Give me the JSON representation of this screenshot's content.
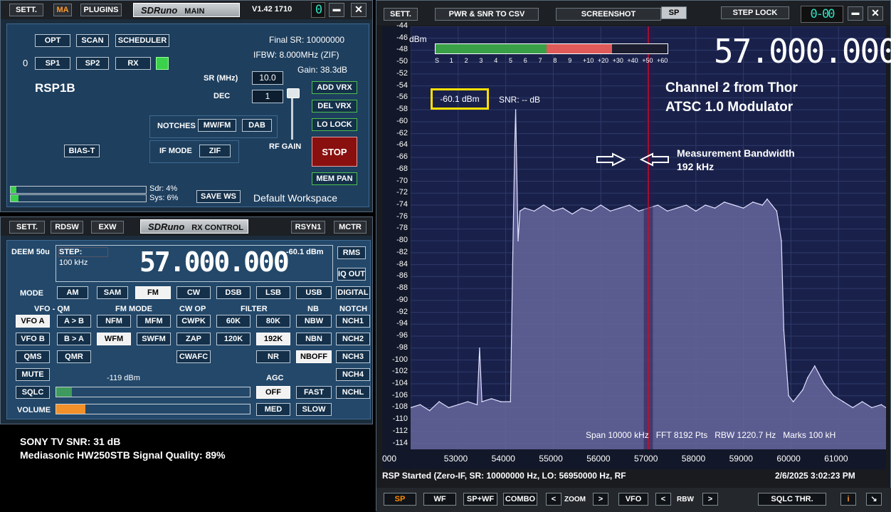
{
  "main_window": {
    "buttons": {
      "sett": "SETT.",
      "ma": "MA",
      "plugins": "PLUGINS"
    },
    "logo": "SDRuno",
    "logo_label": "MAIN",
    "version": "V1.42 1710",
    "counter": "0",
    "opt": "OPT",
    "scan": "SCAN",
    "scheduler": "SCHEDULER",
    "zero": "0",
    "sp1": "SP1",
    "sp2": "SP2",
    "rx": "RX",
    "device": "RSP1B",
    "final_sr": "Final SR: 10000000",
    "ifbw": "IFBW: 8.000MHz (ZIF)",
    "gain": "Gain: 38.3dB",
    "sr_label": "SR (MHz)",
    "sr_value": "10.0",
    "dec_label": "DEC",
    "dec_value": "1",
    "add_vrx": "ADD VRX",
    "del_vrx": "DEL VRX",
    "lo_lock": "LO LOCK",
    "notches_label": "NOTCHES",
    "mwfm": "MW/FM",
    "dab": "DAB",
    "ifmode_label": "IF MODE",
    "zif": "ZIF",
    "rfgain_label": "RF GAIN",
    "stop": "STOP",
    "bias_t": "BIAS-T",
    "mem_pan": "MEM PAN",
    "sdr_load": "Sdr: 4%",
    "sys_load": "Sys: 6%",
    "sdr_pct": 4,
    "sys_pct": 6,
    "save_ws": "SAVE WS",
    "workspace": "Default Workspace"
  },
  "rx_control": {
    "sett": "SETT.",
    "rdsw": "RDSW",
    "exw": "EXW",
    "logo": "SDRuno",
    "logo_label": "RX CONTROL",
    "rsyn1": "RSYN1",
    "mctr": "MCTR",
    "deem": "DEEM 50u",
    "step_label": "STEP:",
    "step_value": "100 kHz",
    "frequency": "57.000.000",
    "level": "-60.1 dBm",
    "rms": "RMS",
    "iq_out": "IQ OUT",
    "digital": "DIGITAL",
    "mode_label": "MODE",
    "modes": [
      "AM",
      "SAM",
      "FM",
      "CW",
      "DSB",
      "LSB",
      "USB"
    ],
    "hdr_vfo": "VFO - QM",
    "hdr_fm": "FM MODE",
    "hdr_cw": "CW OP",
    "hdr_filter": "FILTER",
    "hdr_nb": "NB",
    "hdr_notch": "NOTCH",
    "vfoa": "VFO A",
    "atob": "A > B",
    "nfm": "NFM",
    "mfm": "MFM",
    "cwpk": "CWPK",
    "f60k": "60K",
    "f80k": "80K",
    "nbw": "NBW",
    "nch1": "NCH1",
    "vfob": "VFO B",
    "btoa": "B > A",
    "wfm": "WFM",
    "swfm": "SWFM",
    "zap": "ZAP",
    "f120k": "120K",
    "f192k": "192K",
    "nbn": "NBN",
    "nch2": "NCH2",
    "qms": "QMS",
    "qmr": "QMR",
    "cwafc": "CWAFC",
    "nr": "NR",
    "nboff": "NBOFF",
    "nch3": "NCH3",
    "mute": "MUTE",
    "nch4": "NCH4",
    "sql_level": "-119 dBm",
    "agc_label": "AGC",
    "sqlc": "SQLC",
    "off": "OFF",
    "fast": "FAST",
    "nchl": "NCHL",
    "volume": "VOLUME",
    "med": "MED",
    "slow": "SLOW",
    "squelch_pct": 8,
    "volume_pct": 15
  },
  "annotation": {
    "line1": "SONY TV SNR: 31 dB",
    "line2": "Mediasonic HW250STB Signal Quality: 89%"
  },
  "spectrum": {
    "sett": "SETT.",
    "pwr_snr": "PWR & SNR TO CSV",
    "screenshot": "SCREENSHOT",
    "sp": "SP",
    "step_lock": "STEP LOCK",
    "counter": "0-00",
    "dbm_unit": "dBm",
    "smeter_labels": [
      "S",
      "1",
      "2",
      "3",
      "4",
      "5",
      "6",
      "7",
      "8",
      "9",
      "+10",
      "+20",
      "+30",
      "+40",
      "+50",
      "+60"
    ],
    "frequency": "57.000.000",
    "level_box": "-60.1 dBm",
    "snr": "SNR: -- dB",
    "title1": "Channel 2 from Thor",
    "title2": "ATSC 1.0 Modulator",
    "meas1": "Measurement Bandwidth",
    "meas2": "192 kHz",
    "info": "Span 10000 kHz   FFT 8192 Pts   RBW 1220.7 Hz   Marks 100 kH",
    "status": "RSP Started (Zero-IF, SR: 10000000 Hz, LO: 56950000 Hz, RF",
    "datetime": "2/6/2025 3:02:23 PM",
    "bottom": {
      "sp": "SP",
      "wf": "WF",
      "spwf": "SP+WF",
      "combo": "COMBO",
      "lt": "<",
      "zoom": "ZOOM",
      "gt": ">",
      "vfo": "VFO",
      "rbw": "RBW",
      "sqlc_thr": "SQLC THR.",
      "info": "i"
    },
    "colors": {
      "plot_bg": "#19214a",
      "trace": "#e0e0ff",
      "fill": "#6a6aa0",
      "marker": "#c0102a",
      "box": "#ffe000"
    }
  },
  "chart_data": {
    "type": "area",
    "xlabel": "",
    "ylabel": "dBm",
    "xlim": [
      52000,
      62000
    ],
    "ylim": [
      -115,
      -44
    ],
    "x_ticks": [
      "000",
      "53000",
      "54000",
      "55000",
      "56000",
      "57000",
      "58000",
      "59000",
      "60000",
      "61000"
    ],
    "y_ticks": [
      -44,
      -46,
      -48,
      -50,
      -52,
      -54,
      -56,
      -58,
      -60,
      -62,
      -64,
      -66,
      -68,
      -70,
      -72,
      -74,
      -76,
      -78,
      -80,
      -82,
      -84,
      -86,
      -88,
      -90,
      -92,
      -94,
      -96,
      -98,
      -100,
      -102,
      -104,
      -106,
      -108,
      -110,
      -112,
      -114
    ],
    "x_khz": [
      52000,
      52200,
      52400,
      52600,
      52800,
      53000,
      53200,
      53400,
      53450,
      53500,
      53700,
      53900,
      54100,
      54150,
      54190,
      54210,
      54260,
      54300,
      54400,
      54600,
      54800,
      55000,
      55200,
      55400,
      55600,
      55800,
      56000,
      56200,
      56400,
      56600,
      56800,
      57000,
      57200,
      57400,
      57600,
      57800,
      58000,
      58200,
      58400,
      58600,
      58800,
      59000,
      59200,
      59400,
      59500,
      59600,
      59700,
      59800,
      59850,
      59950,
      60050,
      60150,
      60250,
      60350,
      60500,
      60700,
      60900,
      61100,
      61300,
      61500,
      61700,
      61900,
      62000
    ],
    "y_dbm": [
      -108,
      -107.5,
      -108.5,
      -107,
      -108,
      -107.5,
      -107,
      -107.5,
      -98,
      -107,
      -106.5,
      -107,
      -107,
      -82,
      -64,
      -58,
      -80,
      -75,
      -74.5,
      -75,
      -74,
      -75,
      -74.5,
      -75.5,
      -74.5,
      -75,
      -74,
      -75,
      -74.5,
      -74,
      -75,
      -74.5,
      -74,
      -75,
      -74.5,
      -74,
      -75,
      -74,
      -74.5,
      -73.5,
      -74,
      -74.5,
      -73.5,
      -74,
      -73,
      -74,
      -75,
      -80,
      -95,
      -106,
      -107,
      -106,
      -105,
      -103,
      -101,
      -104,
      -106,
      -107,
      -108,
      -107,
      -108,
      -107.5,
      -108
    ],
    "marker_x": 57000
  }
}
